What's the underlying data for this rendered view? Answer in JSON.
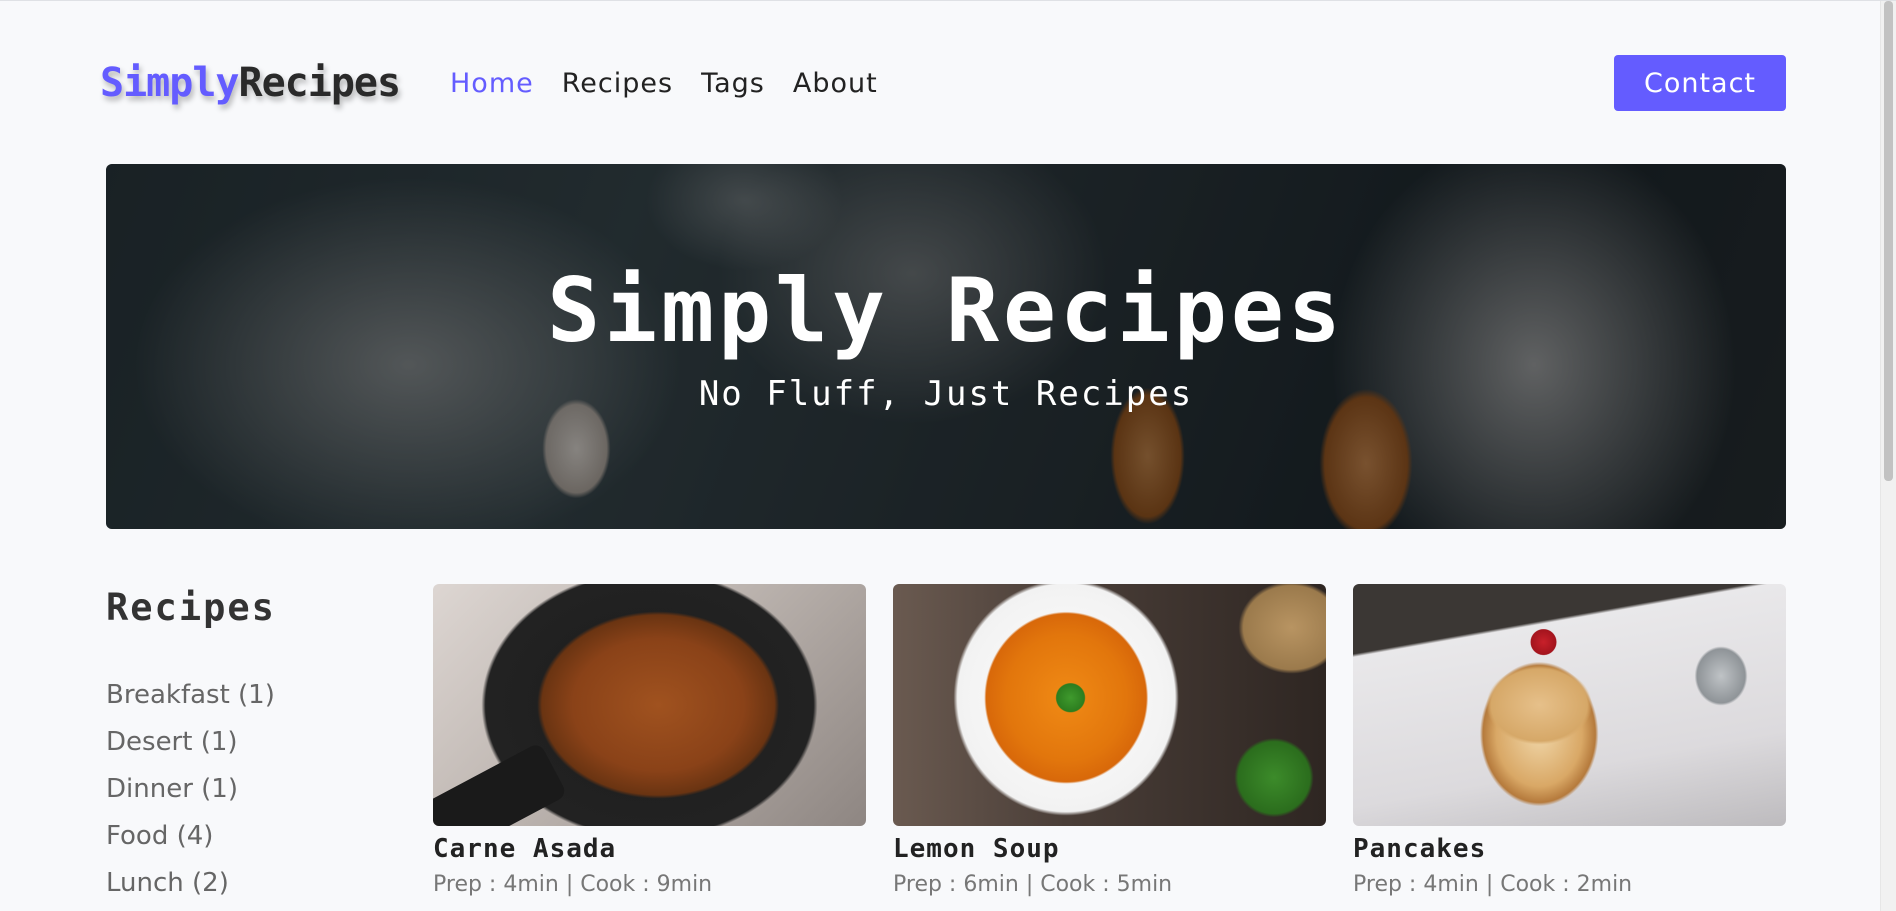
{
  "nav": {
    "logo_part1": "Simply",
    "logo_part2": "Recipes",
    "links": [
      {
        "label": "Home",
        "active": true
      },
      {
        "label": "Recipes",
        "active": false
      },
      {
        "label": "Tags",
        "active": false
      },
      {
        "label": "About",
        "active": false
      }
    ],
    "contact_label": "Contact"
  },
  "hero": {
    "title": "Simply Recipes",
    "subtitle": "No Fluff, Just Recipes"
  },
  "sidebar": {
    "title": "Recipes",
    "tags": [
      "Breakfast (1)",
      "Desert (1)",
      "Dinner (1)",
      "Food (4)",
      "Lunch (2)"
    ]
  },
  "recipes": [
    {
      "title": "Carne Asada",
      "meta": "Prep : 4min | Cook : 9min",
      "image": "carne-asada-photo"
    },
    {
      "title": "Lemon Soup",
      "meta": "Prep : 6min | Cook : 5min",
      "image": "lemon-soup-photo"
    },
    {
      "title": "Pancakes",
      "meta": "Prep : 4min | Cook : 2min",
      "image": "pancakes-photo"
    }
  ],
  "colors": {
    "accent": "#645cff",
    "background": "#f8f9fb",
    "text": "#222222",
    "muted": "#777777"
  }
}
